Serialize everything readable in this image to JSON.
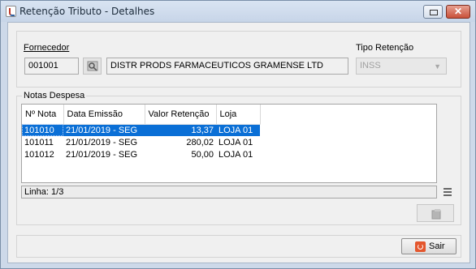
{
  "window": {
    "title": "Retenção Tributo - Detalhes",
    "close_glyph": "✕"
  },
  "header": {
    "fornecedor_label": "Fornecedor",
    "fornecedor_code": "001001",
    "fornecedor_name": "DISTR PRODS FARMACEUTICOS GRAMENSE LTD",
    "tipo_label": "Tipo Retenção",
    "tipo_value": "INSS"
  },
  "notas": {
    "group_label": "Notas Despesa",
    "columns": [
      "Nº Nota",
      "Data Emissão",
      "Valor Retenção",
      "Loja"
    ],
    "rows": [
      [
        "101010",
        "21/01/2019 - SEG",
        "13,37",
        "LOJA 01"
      ],
      [
        "101011",
        "21/01/2019 - SEG",
        "280,02",
        "LOJA 01"
      ],
      [
        "101012",
        "21/01/2019 - SEG",
        "50,00",
        "LOJA 01"
      ]
    ],
    "selected_row": 0,
    "status": "Linha: 1/3"
  },
  "footer": {
    "sair_label": "Sair"
  },
  "icons": [
    "app-icon",
    "minimize-icon",
    "maximize-icon",
    "close-icon",
    "search-icon",
    "menu-icon",
    "grid-action-icon",
    "exit-icon"
  ]
}
